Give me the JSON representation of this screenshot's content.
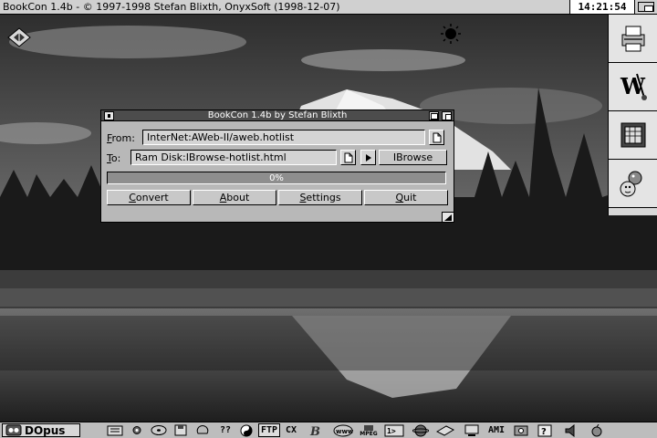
{
  "screen": {
    "title": "BookCon 1.4b - © 1997-1998 Stefan Blixth, OnyxSoft (1998-12-07)",
    "clock": "14:21:54"
  },
  "window": {
    "title": "BookCon 1.4b by Stefan Blixth",
    "from": {
      "label_key": "F",
      "label_rest": "rom:",
      "value": "InterNet:AWeb-II/aweb.hotlist"
    },
    "to": {
      "label_key": "T",
      "label_rest": "o:",
      "value": "Ram Disk:IBrowse-hotlist.html"
    },
    "browser_label": "IBrowse",
    "progress": {
      "value": 0,
      "text": "0%"
    },
    "buttons": {
      "convert": {
        "key": "C",
        "rest": "onvert"
      },
      "about": {
        "key": "A",
        "rest": "bout"
      },
      "settings": {
        "key": "S",
        "rest": "ettings"
      },
      "quit": {
        "key": "Q",
        "rest": "uit"
      }
    }
  },
  "taskbar": {
    "dopus_label": "DOpus",
    "help_label": "??",
    "ftp_label": "FTP",
    "cx_label": "CX",
    "ami_label": "AMI",
    "mpeg_label": "MPEG"
  },
  "icons": [
    "chip-icon",
    "sun-icon",
    "printer-icon",
    "wordworth-icon",
    "frame-icon",
    "globe-person-icon",
    "drawer-icon",
    "tools-icon",
    "disk-icon",
    "save-icon",
    "brain-icon",
    "yin-yang-icon",
    "dopus-b-icon",
    "www-icon",
    "mpeg-icon",
    "shell-icon",
    "planet-icon",
    "paper-icon",
    "monitor-icon",
    "cpu-icon",
    "help-book-icon",
    "speaker-icon",
    "apple-icon"
  ]
}
